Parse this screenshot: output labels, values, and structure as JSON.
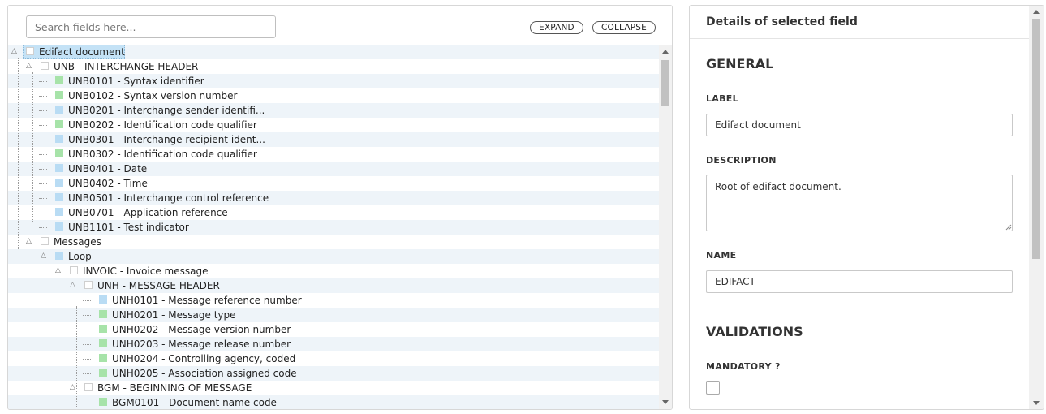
{
  "search": {
    "placeholder": "Search fields here..."
  },
  "toolbar": {
    "expand_label": "EXPAND",
    "collapse_label": "COLLAPSE"
  },
  "tree": {
    "rows": [
      {
        "label": "Edifact document",
        "icon": "empty",
        "selected": true,
        "expander": true,
        "depth": 0
      },
      {
        "label": "UNB - INTERCHANGE HEADER",
        "icon": "empty",
        "expander": true,
        "depth": 1
      },
      {
        "label": "UNB0101 - Syntax identifier",
        "icon": "green",
        "depth": 2
      },
      {
        "label": "UNB0102 - Syntax version number",
        "icon": "green",
        "depth": 2
      },
      {
        "label": "UNB0201 - Interchange sender identifi...",
        "icon": "blue",
        "depth": 2
      },
      {
        "label": "UNB0202 - Identification code qualifier",
        "icon": "green",
        "depth": 2
      },
      {
        "label": "UNB0301 - Interchange recipient ident...",
        "icon": "blue",
        "depth": 2
      },
      {
        "label": "UNB0302 - Identification code qualifier",
        "icon": "green",
        "depth": 2
      },
      {
        "label": "UNB0401 - Date",
        "icon": "blue",
        "depth": 2
      },
      {
        "label": "UNB0402 - Time",
        "icon": "blue",
        "depth": 2
      },
      {
        "label": "UNB0501 - Interchange control reference",
        "icon": "blue",
        "depth": 2
      },
      {
        "label": "UNB0701 - Application reference",
        "icon": "blue",
        "depth": 2
      },
      {
        "label": "UNB1101 - Test indicator",
        "icon": "blue",
        "depth": 2
      },
      {
        "label": "Messages",
        "icon": "empty",
        "expander": true,
        "depth": 1
      },
      {
        "label": "Loop",
        "icon": "blue",
        "expander": true,
        "depth": 2
      },
      {
        "label": "INVOIC - Invoice message",
        "icon": "empty",
        "expander": true,
        "depth": 3
      },
      {
        "label": "UNH - MESSAGE HEADER",
        "icon": "empty",
        "expander": true,
        "depth": 4
      },
      {
        "label": "UNH0101 - Message reference number",
        "icon": "blue",
        "depth": 5
      },
      {
        "label": "UNH0201 - Message type",
        "icon": "green",
        "depth": 5
      },
      {
        "label": "UNH0202 - Message version number",
        "icon": "green",
        "depth": 5
      },
      {
        "label": "UNH0203 - Message release number",
        "icon": "green",
        "depth": 5
      },
      {
        "label": "UNH0204 - Controlling agency, coded",
        "icon": "green",
        "depth": 5
      },
      {
        "label": "UNH0205 - Association assigned code",
        "icon": "green",
        "depth": 5
      },
      {
        "label": "BGM - BEGINNING OF MESSAGE",
        "icon": "empty",
        "expander": true,
        "depth": 4
      },
      {
        "label": "BGM0101 - Document name code",
        "icon": "green",
        "depth": 5
      }
    ]
  },
  "details": {
    "header": "Details of selected field",
    "general_title": "GENERAL",
    "label_label": "LABEL",
    "label_value": "Edifact document",
    "description_label": "DESCRIPTION",
    "description_value": "Root of edifact document.",
    "name_label": "NAME",
    "name_value": "EDIFACT",
    "validations_title": "VALIDATIONS",
    "mandatory_label": "MANDATORY ?",
    "mandatory_checked": false
  },
  "colors": {
    "green": "#a7e3a9",
    "blue": "#b9dcf4",
    "selected": "#c4e2f6",
    "row_alt": "#eef4f9"
  }
}
